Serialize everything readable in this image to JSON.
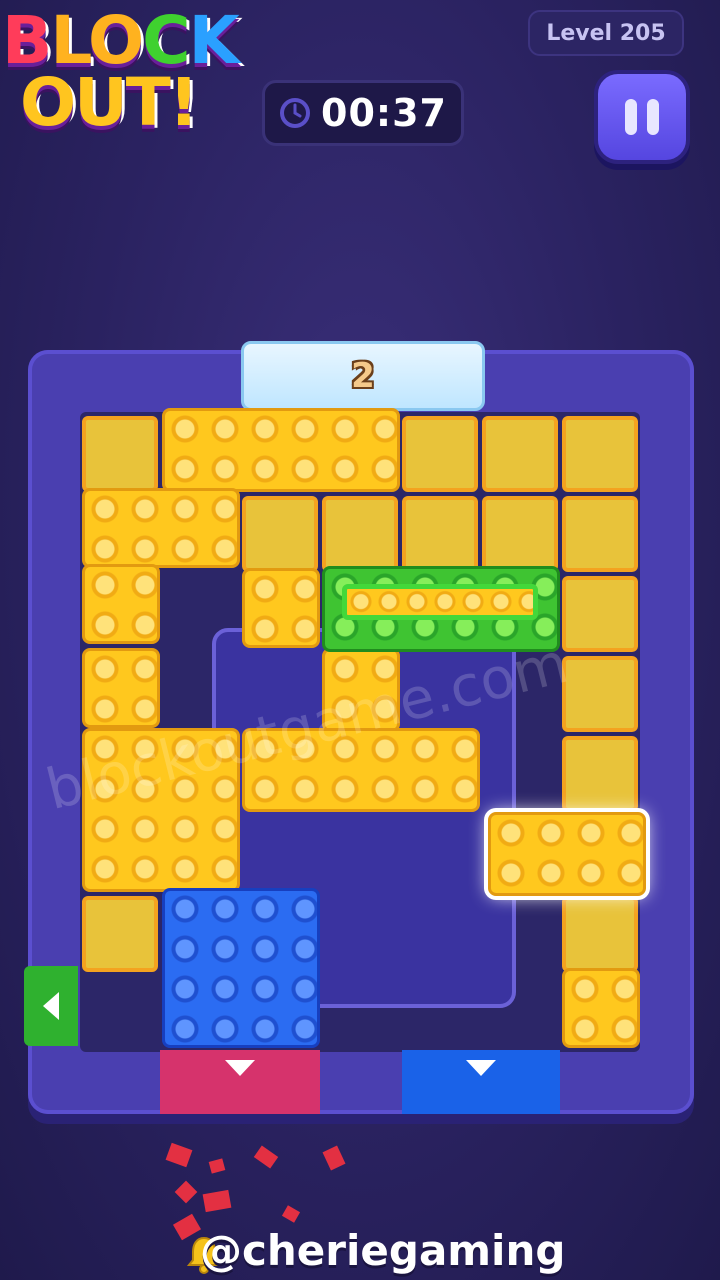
{
  "logo": {
    "line1": "BLOCK",
    "line2": "OUT!",
    "line1_colors": [
      "#ff3c5a",
      "#ffb21f",
      "#ffb21f",
      "#3fd12f",
      "#2aa0ff"
    ]
  },
  "level_label": "Level 205",
  "timer": {
    "value": "00:37",
    "icon": "clock-icon"
  },
  "pause_icon": "pause-icon",
  "exit_top_count": "2",
  "watermark": "blockoutgame.com",
  "handle": "@cheriegaming",
  "colors": {
    "yellow": "#ffc81e",
    "green": "#3fc432",
    "blue": "#2b6cf2",
    "red_exit": "#d6336c",
    "blue_exit": "#1a62e8",
    "board": "#4a3fb0"
  }
}
